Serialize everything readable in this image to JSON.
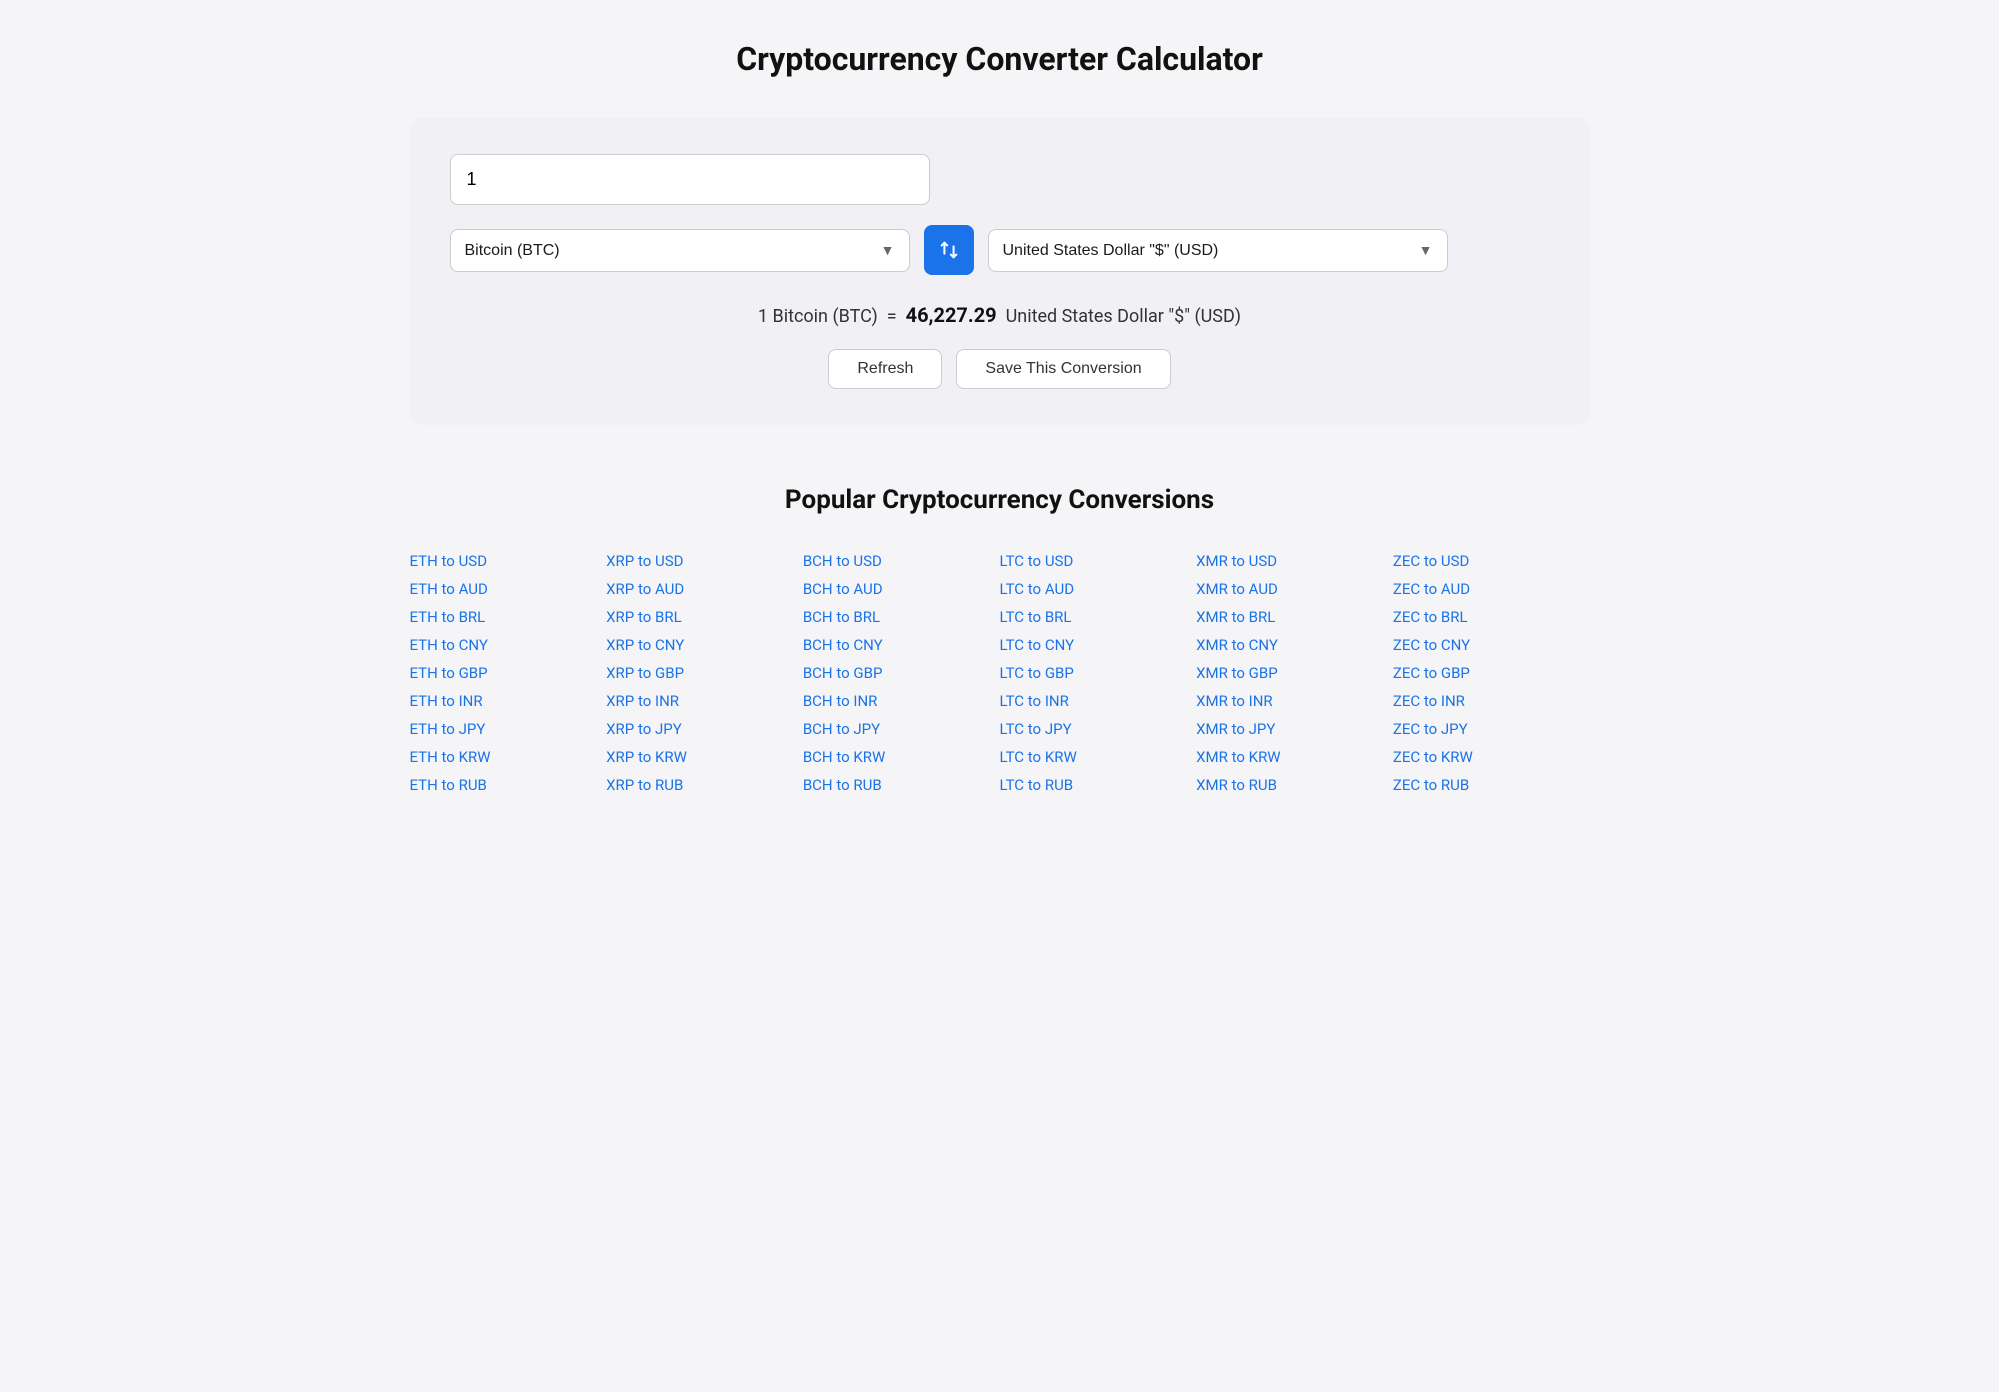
{
  "page": {
    "title": "Cryptocurrency Converter Calculator"
  },
  "converter": {
    "amount_value": "1",
    "from_currency": "Bitcoin (BTC)",
    "to_currency": "United States Dollar \"$\" (USD)",
    "result_text": "1 Bitcoin (BTC)",
    "equals": "=",
    "result_value": "46,227.29",
    "result_currency": "United States Dollar \"$\" (USD)",
    "refresh_label": "Refresh",
    "save_label": "Save This Conversion",
    "swap_icon": "⇄"
  },
  "popular": {
    "title": "Popular Cryptocurrency Conversions",
    "columns": [
      {
        "links": [
          "ETH to USD",
          "ETH to AUD",
          "ETH to BRL",
          "ETH to CNY",
          "ETH to GBP",
          "ETH to INR",
          "ETH to JPY",
          "ETH to KRW",
          "ETH to RUB"
        ]
      },
      {
        "links": [
          "XRP to USD",
          "XRP to AUD",
          "XRP to BRL",
          "XRP to CNY",
          "XRP to GBP",
          "XRP to INR",
          "XRP to JPY",
          "XRP to KRW",
          "XRP to RUB"
        ]
      },
      {
        "links": [
          "BCH to USD",
          "BCH to AUD",
          "BCH to BRL",
          "BCH to CNY",
          "BCH to GBP",
          "BCH to INR",
          "BCH to JPY",
          "BCH to KRW",
          "BCH to RUB"
        ]
      },
      {
        "links": [
          "LTC to USD",
          "LTC to AUD",
          "LTC to BRL",
          "LTC to CNY",
          "LTC to GBP",
          "LTC to INR",
          "LTC to JPY",
          "LTC to KRW",
          "LTC to RUB"
        ]
      },
      {
        "links": [
          "XMR to USD",
          "XMR to AUD",
          "XMR to BRL",
          "XMR to CNY",
          "XMR to GBP",
          "XMR to INR",
          "XMR to JPY",
          "XMR to KRW",
          "XMR to RUB"
        ]
      },
      {
        "links": [
          "ZEC to USD",
          "ZEC to AUD",
          "ZEC to BRL",
          "ZEC to CNY",
          "ZEC to GBP",
          "ZEC to INR",
          "ZEC to JPY",
          "ZEC to KRW",
          "ZEC to RUB"
        ]
      }
    ]
  }
}
